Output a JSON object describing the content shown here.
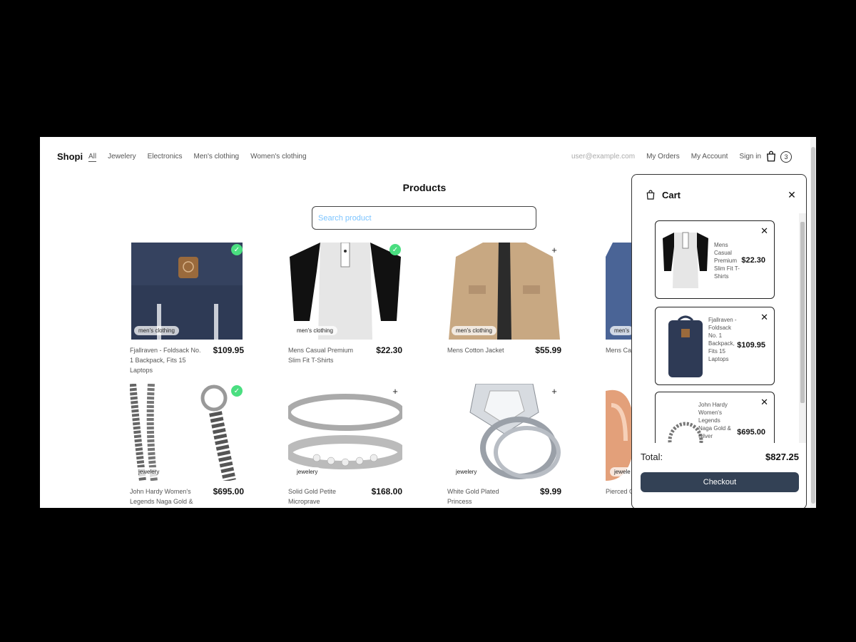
{
  "nav": {
    "brand": "Shopi",
    "categories": [
      "All",
      "Jewelery",
      "Electronics",
      "Men's clothing",
      "Women's clothing"
    ],
    "email": "user@example.com",
    "my_orders": "My Orders",
    "my_account": "My Account",
    "sign_in": "Sign in",
    "cart_count": "3"
  },
  "main": {
    "title": "Products",
    "search_placeholder": "Search product"
  },
  "products": [
    {
      "name": "Fjallraven - Foldsack No. 1 Backpack, Fits 15 Laptops",
      "price": "$109.95",
      "category": "men's clothing",
      "in_cart": true
    },
    {
      "name": "Mens Casual Premium Slim Fit T-Shirts",
      "price": "$22.30",
      "category": "men's clothing",
      "in_cart": true
    },
    {
      "name": "Mens Cotton Jacket",
      "price": "$55.99",
      "category": "men's clothing",
      "in_cart": false
    },
    {
      "name": "Mens Ca",
      "price": "",
      "category": "men's",
      "in_cart": false
    },
    {
      "name": "John Hardy Women's Legends Naga Gold &",
      "price": "$695.00",
      "category": "jewelery",
      "in_cart": true
    },
    {
      "name": "Solid Gold Petite Microprave",
      "price": "$168.00",
      "category": "jewelery",
      "in_cart": false
    },
    {
      "name": "White Gold Plated Princess",
      "price": "$9.99",
      "category": "jewelery",
      "in_cart": false
    },
    {
      "name": "Pierced O Plated St",
      "price": "",
      "category": "jewele",
      "in_cart": false
    }
  ],
  "cart": {
    "title": "Cart",
    "items": [
      {
        "name": "Mens Casual Premium Slim Fit T-Shirts",
        "price": "$22.30"
      },
      {
        "name": "Fjallraven - Foldsack No. 1 Backpack, Fits 15 Laptops",
        "price": "$109.95"
      },
      {
        "name": "John Hardy Women's Legends Naga Gold & Silver",
        "price": "$695.00"
      }
    ],
    "total_label": "Total:",
    "total_value": "$827.25",
    "checkout_label": "Checkout"
  },
  "colors": {
    "added": "#4ade80",
    "checkout": "#334155",
    "placeholder": "#7cc4ff"
  }
}
